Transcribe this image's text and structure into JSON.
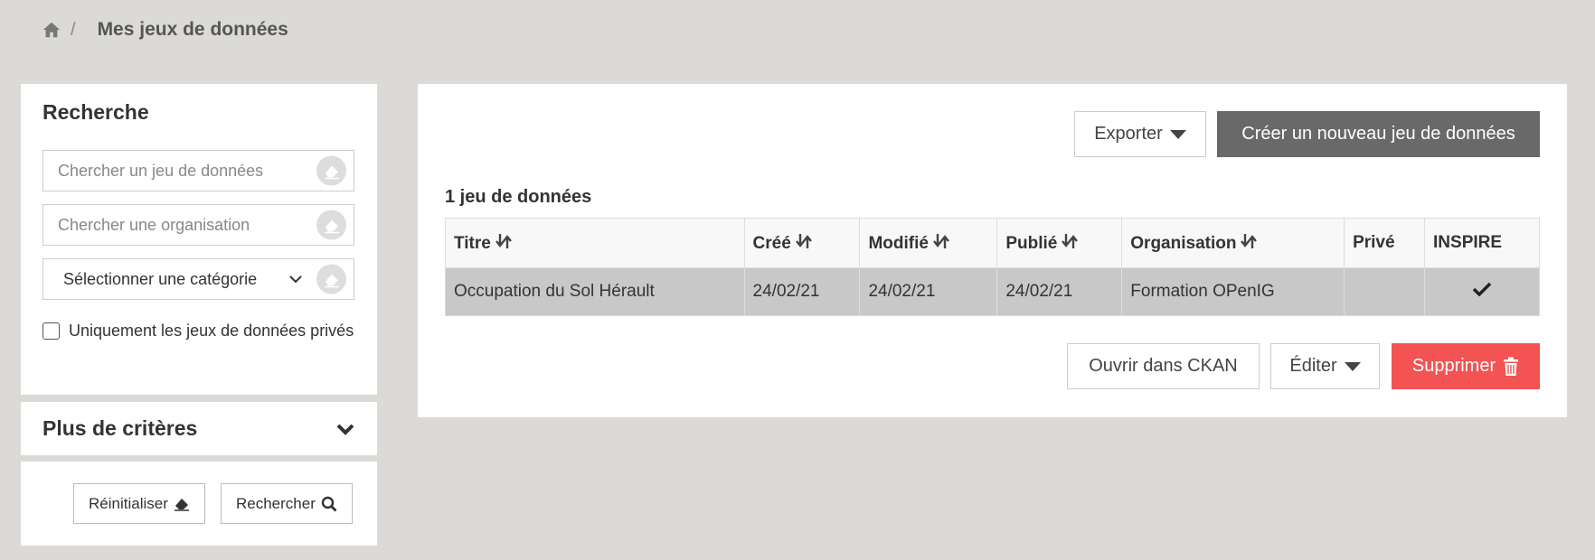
{
  "breadcrumb": {
    "home_icon": "home-icon",
    "separator": "/",
    "current": "Mes jeux de données"
  },
  "search": {
    "title": "Recherche",
    "dataset_placeholder": "Chercher un jeu de données",
    "organization_placeholder": "Chercher une organisation",
    "category_selected": "Sélectionner une catégorie",
    "private_only_label": "Uniquement les jeux de données privés"
  },
  "criteria": {
    "title": "Plus de critères"
  },
  "sidebar_actions": {
    "reset_label": "Réinitialiser",
    "search_label": "Rechercher"
  },
  "toolbar": {
    "export_label": "Exporter",
    "create_label": "Créer un nouveau jeu de données"
  },
  "results": {
    "count_label": "1 jeu de données",
    "columns": [
      "Titre",
      "Créé",
      "Modifié",
      "Publié",
      "Organisation",
      "Privé",
      "INSPIRE"
    ],
    "rows": [
      {
        "title": "Occupation du Sol Hérault",
        "created": "24/02/21",
        "modified": "24/02/21",
        "published": "24/02/21",
        "organization": "Formation OPenIG",
        "private": "",
        "inspire": true
      }
    ]
  },
  "row_actions": {
    "open_label": "Ouvrir dans CKAN",
    "edit_label": "Éditer",
    "delete_label": "Supprimer"
  },
  "colors": {
    "background": "#dcdad7",
    "primary_dark": "#696969",
    "danger": "#f35353",
    "selected_row": "#c8c8c8"
  }
}
